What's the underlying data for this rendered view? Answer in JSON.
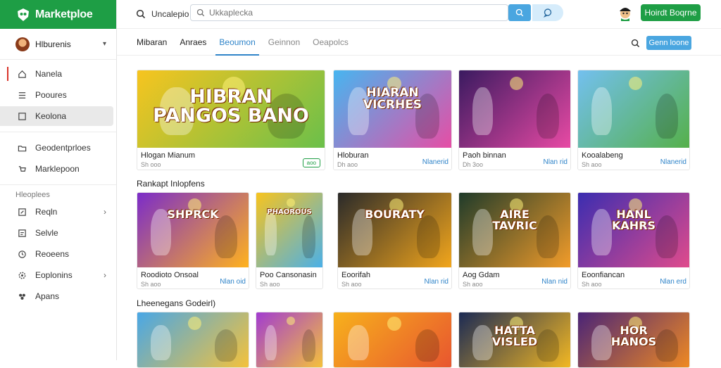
{
  "brand": {
    "name": "Marketploe"
  },
  "user": {
    "name": "Hlburenis"
  },
  "sidebar": {
    "items": [
      {
        "label": "Nanela",
        "icon": "home-icon"
      },
      {
        "label": "Pooures",
        "icon": "list-icon"
      },
      {
        "label": "Keolona",
        "icon": "square-icon"
      },
      {
        "label": "Geodentprloes",
        "icon": "folder-icon"
      },
      {
        "label": "Marklepoon",
        "icon": "cart-icon"
      }
    ],
    "section_label": "Hleoplees",
    "section_items": [
      {
        "label": "Reqln",
        "icon": "edit-icon",
        "has_chevron": true
      },
      {
        "label": "Selvle",
        "icon": "doc-icon",
        "has_chevron": false
      },
      {
        "label": "Reoeens",
        "icon": "clock-icon",
        "has_chevron": false
      },
      {
        "label": "Eoplonins",
        "icon": "settings-icon",
        "has_chevron": true
      },
      {
        "label": "Apans",
        "icon": "gear-icon",
        "has_chevron": false
      }
    ]
  },
  "topbar": {
    "label": "Uncalepio",
    "search_placeholder": "Ukkaplecka",
    "cta_label": "Hoirdt Boqrne"
  },
  "tabs": [
    {
      "label": "Mibaran",
      "state": "normal"
    },
    {
      "label": "Anraes",
      "state": "normal"
    },
    {
      "label": "Beoumon",
      "state": "active"
    },
    {
      "label": "Geinnon",
      "state": "muted"
    },
    {
      "label": "Oeapolcs",
      "state": "muted"
    }
  ],
  "tab_button_label": "Genn loone",
  "rows": [
    {
      "title": "",
      "cards": [
        {
          "art_text": "HIBRAN\nPANGOS BANO",
          "title": "Hlogan Mianum",
          "meta": "Sh ooo",
          "action": "aoo",
          "action_type": "tag",
          "colors": [
            "#f7c41f",
            "#6bc04a"
          ]
        },
        {
          "art_text": "HIARAN\nVICRHES",
          "title": "Hloburan",
          "meta": "Dh aoo",
          "action": "Nlanerid",
          "action_type": "link",
          "colors": [
            "#47b5f0",
            "#e64ea5"
          ]
        },
        {
          "art_text": "",
          "title": "Paoh binnan",
          "meta": "Dh 3oo",
          "action": "Nlan rid",
          "action_type": "link",
          "colors": [
            "#3a1a60",
            "#e84aa4"
          ]
        },
        {
          "art_text": "",
          "title": "Kooalabeng",
          "meta": "Sh aoo",
          "action": "Nlanerid",
          "action_type": "link",
          "colors": [
            "#73c0ef",
            "#55b04a"
          ]
        }
      ]
    },
    {
      "title": "Rankapt Inlopfens",
      "cards": [
        {
          "art_text": "SHPRCK",
          "title": "Roodioto Onsoal",
          "meta": "Sh aoo",
          "action": "Nlan oid",
          "action_type": "link",
          "colors": [
            "#7b2cc9",
            "#ffb21e"
          ]
        },
        {
          "art_text": "PHAOROUS",
          "title": "Poo Cansonasin",
          "meta": "Sh aoo",
          "action": "",
          "action_type": "none",
          "colors": [
            "#f7c41f",
            "#4ab0e8"
          ]
        },
        {
          "art_text": "BOURATY",
          "title": "Eoorifah",
          "meta": "Sh aoo",
          "action": "Nlan rid",
          "action_type": "link",
          "colors": [
            "#2a2a2a",
            "#f2a61c"
          ]
        },
        {
          "art_text": "AIRE\nTAVRIC",
          "title": "Aog Gdam",
          "meta": "Sh aoo",
          "action": "Nlan nid",
          "action_type": "link",
          "colors": [
            "#1f3b2a",
            "#f29c2a"
          ]
        },
        {
          "art_text": "HANL\nKAHRS",
          "title": "Eoonfiancan",
          "meta": "Sh aoo",
          "action": "Nlan erd",
          "action_type": "link",
          "colors": [
            "#3b2db0",
            "#e04b8c"
          ]
        }
      ]
    },
    {
      "title": "Lheenegans Godeirl)",
      "cards": [
        {
          "art_text": "",
          "colors": [
            "#49a7e6",
            "#f5c23a"
          ]
        },
        {
          "art_text": "",
          "colors": [
            "#a23cd0",
            "#f5c23a"
          ]
        },
        {
          "art_text": "",
          "colors": [
            "#f7b11c",
            "#e8552f"
          ]
        },
        {
          "art_text": "HATTA\nVISLED",
          "colors": [
            "#1b2a54",
            "#f4b923"
          ]
        },
        {
          "art_text": "HOR\nHANOS",
          "colors": [
            "#4a2477",
            "#f08a22"
          ]
        }
      ]
    }
  ]
}
